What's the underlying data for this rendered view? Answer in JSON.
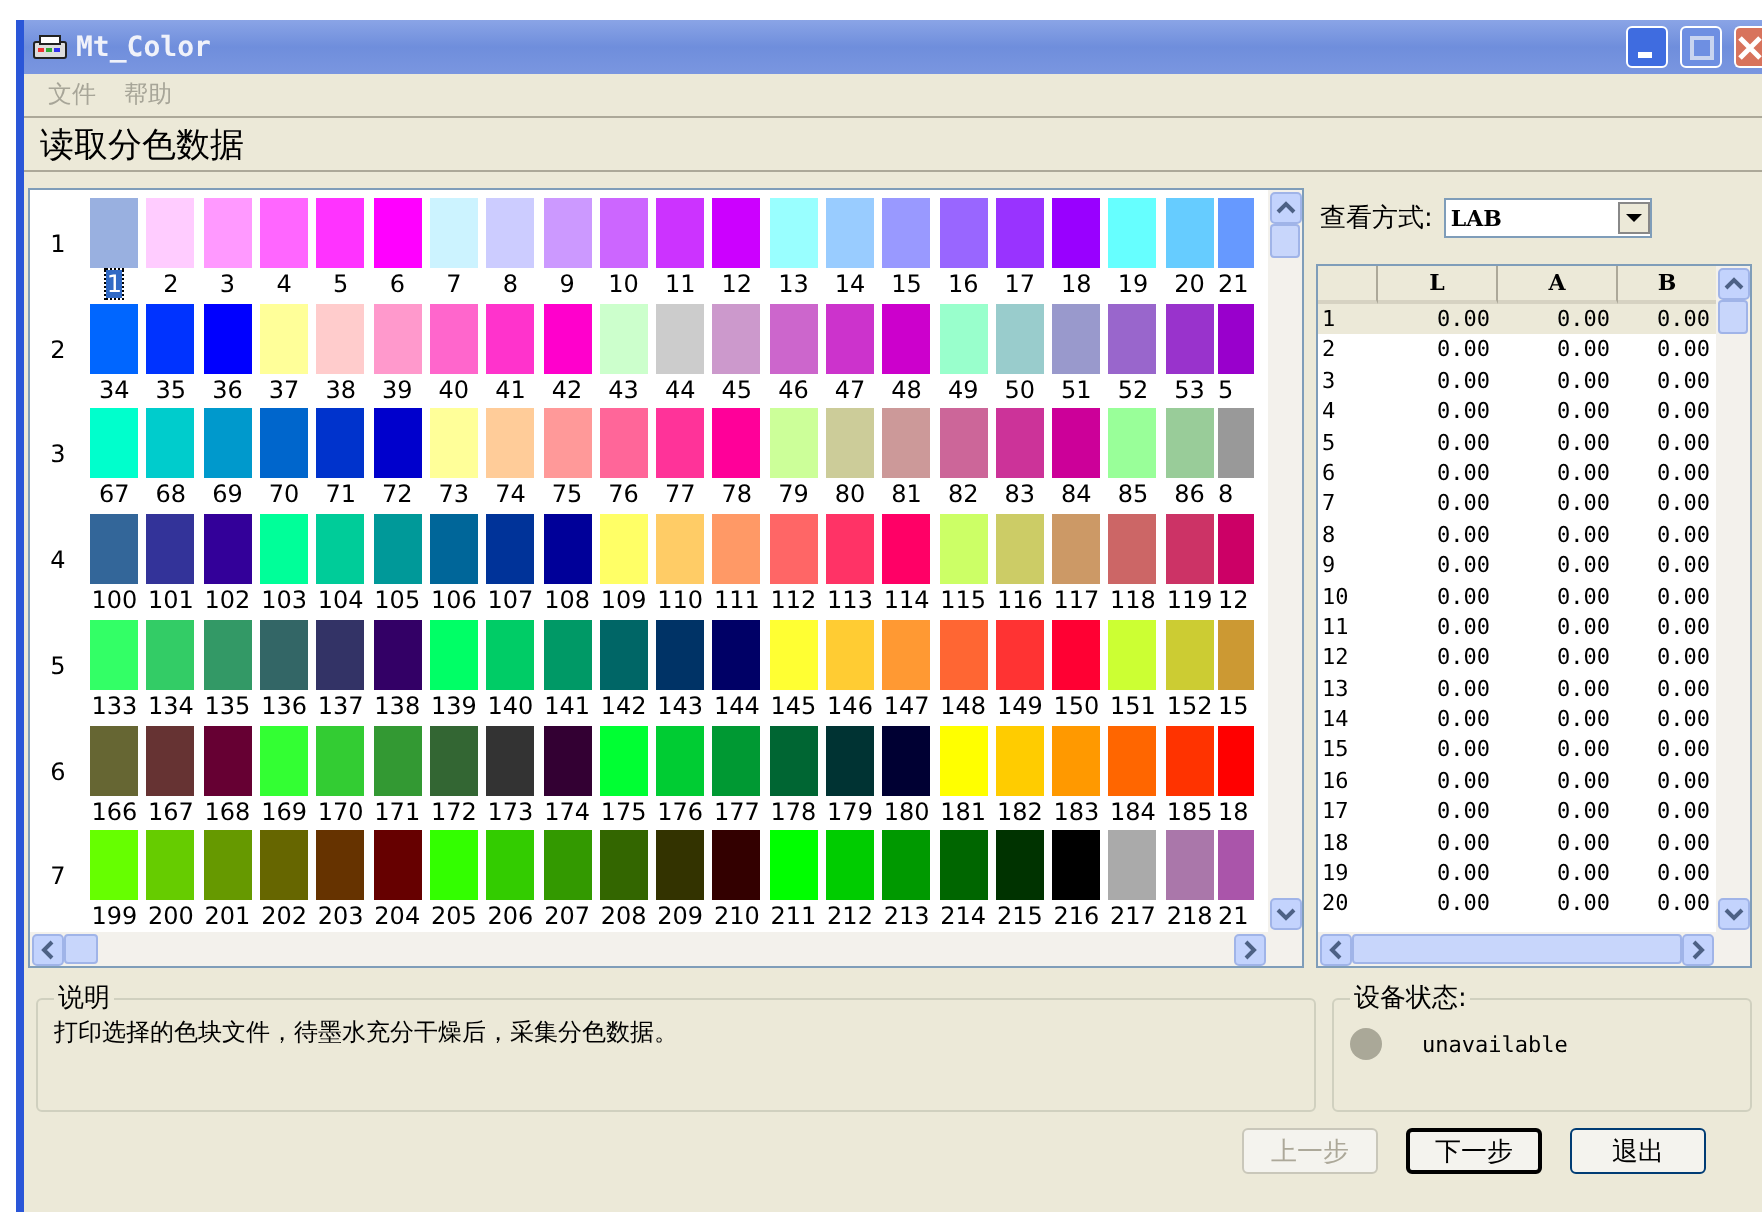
{
  "window": {
    "title": "Mt_Color"
  },
  "menu": [
    {
      "label": "文件",
      "disabled": true
    },
    {
      "label": "帮助",
      "disabled": true
    }
  ],
  "page_title": "读取分色数据",
  "swatch_grid": {
    "rows": [
      {
        "label": "1",
        "swatches": [
          {
            "label": "1",
            "color": "#99b0e0",
            "selected": true
          },
          {
            "label": "2",
            "color": "#ffccff",
            "selected": false
          },
          {
            "label": "3",
            "color": "#ff99ff",
            "selected": false
          },
          {
            "label": "4",
            "color": "#ff66ff",
            "selected": false
          },
          {
            "label": "5",
            "color": "#ff33ff",
            "selected": false
          },
          {
            "label": "6",
            "color": "#ff00ff",
            "selected": false
          },
          {
            "label": "7",
            "color": "#ccf3ff",
            "selected": false
          },
          {
            "label": "8",
            "color": "#ccccff",
            "selected": false
          },
          {
            "label": "9",
            "color": "#cc99ff",
            "selected": false
          },
          {
            "label": "10",
            "color": "#cc66ff",
            "selected": false
          },
          {
            "label": "11",
            "color": "#cc33ff",
            "selected": false
          },
          {
            "label": "12",
            "color": "#cc00ff",
            "selected": false
          },
          {
            "label": "13",
            "color": "#99ffff",
            "selected": false
          },
          {
            "label": "14",
            "color": "#99ccff",
            "selected": false
          },
          {
            "label": "15",
            "color": "#9999ff",
            "selected": false
          },
          {
            "label": "16",
            "color": "#9966ff",
            "selected": false
          },
          {
            "label": "17",
            "color": "#9933ff",
            "selected": false
          },
          {
            "label": "18",
            "color": "#9900ff",
            "selected": false
          },
          {
            "label": "19",
            "color": "#66ffff",
            "selected": false
          },
          {
            "label": "20",
            "color": "#66ccff",
            "selected": false
          },
          {
            "label": "21",
            "color": "#6699ff",
            "selected": false
          }
        ]
      },
      {
        "label": "2",
        "swatches": [
          {
            "label": "34",
            "color": "#0066ff",
            "selected": false
          },
          {
            "label": "35",
            "color": "#0033ff",
            "selected": false
          },
          {
            "label": "36",
            "color": "#0000ff",
            "selected": false
          },
          {
            "label": "37",
            "color": "#ffff99",
            "selected": false
          },
          {
            "label": "38",
            "color": "#ffcccc",
            "selected": false
          },
          {
            "label": "39",
            "color": "#ff99cc",
            "selected": false
          },
          {
            "label": "40",
            "color": "#ff66cc",
            "selected": false
          },
          {
            "label": "41",
            "color": "#ff33cc",
            "selected": false
          },
          {
            "label": "42",
            "color": "#ff00cc",
            "selected": false
          },
          {
            "label": "43",
            "color": "#ccffcc",
            "selected": false
          },
          {
            "label": "44",
            "color": "#cccccc",
            "selected": false
          },
          {
            "label": "45",
            "color": "#cc99cc",
            "selected": false
          },
          {
            "label": "46",
            "color": "#cc66cc",
            "selected": false
          },
          {
            "label": "47",
            "color": "#cc33cc",
            "selected": false
          },
          {
            "label": "48",
            "color": "#cc00cc",
            "selected": false
          },
          {
            "label": "49",
            "color": "#99ffcc",
            "selected": false
          },
          {
            "label": "50",
            "color": "#99cccc",
            "selected": false
          },
          {
            "label": "51",
            "color": "#9999cc",
            "selected": false
          },
          {
            "label": "52",
            "color": "#9966cc",
            "selected": false
          },
          {
            "label": "53",
            "color": "#9933cc",
            "selected": false
          },
          {
            "label": "5",
            "color": "#9900cc",
            "selected": false
          }
        ]
      },
      {
        "label": "3",
        "swatches": [
          {
            "label": "67",
            "color": "#00ffcc",
            "selected": false
          },
          {
            "label": "68",
            "color": "#00cccc",
            "selected": false
          },
          {
            "label": "69",
            "color": "#0099cc",
            "selected": false
          },
          {
            "label": "70",
            "color": "#0066cc",
            "selected": false
          },
          {
            "label": "71",
            "color": "#0033cc",
            "selected": false
          },
          {
            "label": "72",
            "color": "#0000cc",
            "selected": false
          },
          {
            "label": "73",
            "color": "#ffff99",
            "selected": false
          },
          {
            "label": "74",
            "color": "#ffcc99",
            "selected": false
          },
          {
            "label": "75",
            "color": "#ff9999",
            "selected": false
          },
          {
            "label": "76",
            "color": "#ff6699",
            "selected": false
          },
          {
            "label": "77",
            "color": "#ff3399",
            "selected": false
          },
          {
            "label": "78",
            "color": "#ff0099",
            "selected": false
          },
          {
            "label": "79",
            "color": "#ccff99",
            "selected": false
          },
          {
            "label": "80",
            "color": "#cccc99",
            "selected": false
          },
          {
            "label": "81",
            "color": "#cc9999",
            "selected": false
          },
          {
            "label": "82",
            "color": "#cc6699",
            "selected": false
          },
          {
            "label": "83",
            "color": "#cc3399",
            "selected": false
          },
          {
            "label": "84",
            "color": "#cc0099",
            "selected": false
          },
          {
            "label": "85",
            "color": "#99ff99",
            "selected": false
          },
          {
            "label": "86",
            "color": "#99cc99",
            "selected": false
          },
          {
            "label": "8",
            "color": "#999999",
            "selected": false
          }
        ]
      },
      {
        "label": "4",
        "swatches": [
          {
            "label": "100",
            "color": "#336699",
            "selected": false
          },
          {
            "label": "101",
            "color": "#333399",
            "selected": false
          },
          {
            "label": "102",
            "color": "#330099",
            "selected": false
          },
          {
            "label": "103",
            "color": "#00ff99",
            "selected": false
          },
          {
            "label": "104",
            "color": "#00cc99",
            "selected": false
          },
          {
            "label": "105",
            "color": "#009999",
            "selected": false
          },
          {
            "label": "106",
            "color": "#006699",
            "selected": false
          },
          {
            "label": "107",
            "color": "#003399",
            "selected": false
          },
          {
            "label": "108",
            "color": "#000099",
            "selected": false
          },
          {
            "label": "109",
            "color": "#ffff66",
            "selected": false
          },
          {
            "label": "110",
            "color": "#ffcc66",
            "selected": false
          },
          {
            "label": "111",
            "color": "#ff9966",
            "selected": false
          },
          {
            "label": "112",
            "color": "#ff6666",
            "selected": false
          },
          {
            "label": "113",
            "color": "#ff3366",
            "selected": false
          },
          {
            "label": "114",
            "color": "#ff0066",
            "selected": false
          },
          {
            "label": "115",
            "color": "#ccff66",
            "selected": false
          },
          {
            "label": "116",
            "color": "#cccc66",
            "selected": false
          },
          {
            "label": "117",
            "color": "#cc9966",
            "selected": false
          },
          {
            "label": "118",
            "color": "#cc6666",
            "selected": false
          },
          {
            "label": "119",
            "color": "#cc3366",
            "selected": false
          },
          {
            "label": "12",
            "color": "#cc0066",
            "selected": false
          }
        ]
      },
      {
        "label": "5",
        "swatches": [
          {
            "label": "133",
            "color": "#33ff66",
            "selected": false
          },
          {
            "label": "134",
            "color": "#33cc66",
            "selected": false
          },
          {
            "label": "135",
            "color": "#339966",
            "selected": false
          },
          {
            "label": "136",
            "color": "#336666",
            "selected": false
          },
          {
            "label": "137",
            "color": "#333366",
            "selected": false
          },
          {
            "label": "138",
            "color": "#330066",
            "selected": false
          },
          {
            "label": "139",
            "color": "#00ff66",
            "selected": false
          },
          {
            "label": "140",
            "color": "#00cc66",
            "selected": false
          },
          {
            "label": "141",
            "color": "#009966",
            "selected": false
          },
          {
            "label": "142",
            "color": "#006666",
            "selected": false
          },
          {
            "label": "143",
            "color": "#003366",
            "selected": false
          },
          {
            "label": "144",
            "color": "#000066",
            "selected": false
          },
          {
            "label": "145",
            "color": "#ffff33",
            "selected": false
          },
          {
            "label": "146",
            "color": "#ffcc33",
            "selected": false
          },
          {
            "label": "147",
            "color": "#ff9933",
            "selected": false
          },
          {
            "label": "148",
            "color": "#ff6633",
            "selected": false
          },
          {
            "label": "149",
            "color": "#ff3333",
            "selected": false
          },
          {
            "label": "150",
            "color": "#ff0033",
            "selected": false
          },
          {
            "label": "151",
            "color": "#ccff33",
            "selected": false
          },
          {
            "label": "152",
            "color": "#cccc33",
            "selected": false
          },
          {
            "label": "15",
            "color": "#cc9933",
            "selected": false
          }
        ]
      },
      {
        "label": "6",
        "swatches": [
          {
            "label": "166",
            "color": "#666633",
            "selected": false
          },
          {
            "label": "167",
            "color": "#663333",
            "selected": false
          },
          {
            "label": "168",
            "color": "#660033",
            "selected": false
          },
          {
            "label": "169",
            "color": "#33ff33",
            "selected": false
          },
          {
            "label": "170",
            "color": "#33cc33",
            "selected": false
          },
          {
            "label": "171",
            "color": "#339933",
            "selected": false
          },
          {
            "label": "172",
            "color": "#336633",
            "selected": false
          },
          {
            "label": "173",
            "color": "#333333",
            "selected": false
          },
          {
            "label": "174",
            "color": "#330033",
            "selected": false
          },
          {
            "label": "175",
            "color": "#00ff33",
            "selected": false
          },
          {
            "label": "176",
            "color": "#00cc33",
            "selected": false
          },
          {
            "label": "177",
            "color": "#009933",
            "selected": false
          },
          {
            "label": "178",
            "color": "#006633",
            "selected": false
          },
          {
            "label": "179",
            "color": "#003333",
            "selected": false
          },
          {
            "label": "180",
            "color": "#000033",
            "selected": false
          },
          {
            "label": "181",
            "color": "#ffff00",
            "selected": false
          },
          {
            "label": "182",
            "color": "#ffcc00",
            "selected": false
          },
          {
            "label": "183",
            "color": "#ff9900",
            "selected": false
          },
          {
            "label": "184",
            "color": "#ff6600",
            "selected": false
          },
          {
            "label": "185",
            "color": "#ff3300",
            "selected": false
          },
          {
            "label": "18",
            "color": "#ff0000",
            "selected": false
          }
        ]
      },
      {
        "label": "7",
        "swatches": [
          {
            "label": "199",
            "color": "#66ff00",
            "selected": false
          },
          {
            "label": "200",
            "color": "#66cc00",
            "selected": false
          },
          {
            "label": "201",
            "color": "#669900",
            "selected": false
          },
          {
            "label": "202",
            "color": "#666600",
            "selected": false
          },
          {
            "label": "203",
            "color": "#663300",
            "selected": false
          },
          {
            "label": "204",
            "color": "#660000",
            "selected": false
          },
          {
            "label": "205",
            "color": "#33ff00",
            "selected": false
          },
          {
            "label": "206",
            "color": "#33cc00",
            "selected": false
          },
          {
            "label": "207",
            "color": "#339900",
            "selected": false
          },
          {
            "label": "208",
            "color": "#336600",
            "selected": false
          },
          {
            "label": "209",
            "color": "#333300",
            "selected": false
          },
          {
            "label": "210",
            "color": "#330000",
            "selected": false
          },
          {
            "label": "211",
            "color": "#00ff00",
            "selected": false
          },
          {
            "label": "212",
            "color": "#00cc00",
            "selected": false
          },
          {
            "label": "213",
            "color": "#009900",
            "selected": false
          },
          {
            "label": "214",
            "color": "#006600",
            "selected": false
          },
          {
            "label": "215",
            "color": "#003300",
            "selected": false
          },
          {
            "label": "216",
            "color": "#000000",
            "selected": false
          },
          {
            "label": "217",
            "color": "#aaaaaa",
            "selected": false
          },
          {
            "label": "218",
            "color": "#aa77aa",
            "selected": false
          },
          {
            "label": "21",
            "color": "#aa55aa",
            "selected": false
          }
        ]
      }
    ]
  },
  "view_mode": {
    "label": "查看方式:",
    "value": "LAB"
  },
  "table": {
    "columns": [
      "L",
      "A",
      "B"
    ],
    "rows": [
      {
        "index": "1",
        "l": "0.00",
        "a": "0.00",
        "b": "0.00",
        "selected": true
      },
      {
        "index": "2",
        "l": "0.00",
        "a": "0.00",
        "b": "0.00",
        "selected": false
      },
      {
        "index": "3",
        "l": "0.00",
        "a": "0.00",
        "b": "0.00",
        "selected": false
      },
      {
        "index": "4",
        "l": "0.00",
        "a": "0.00",
        "b": "0.00",
        "selected": false
      },
      {
        "index": "5",
        "l": "0.00",
        "a": "0.00",
        "b": "0.00",
        "selected": false
      },
      {
        "index": "6",
        "l": "0.00",
        "a": "0.00",
        "b": "0.00",
        "selected": false
      },
      {
        "index": "7",
        "l": "0.00",
        "a": "0.00",
        "b": "0.00",
        "selected": false
      },
      {
        "index": "8",
        "l": "0.00",
        "a": "0.00",
        "b": "0.00",
        "selected": false
      },
      {
        "index": "9",
        "l": "0.00",
        "a": "0.00",
        "b": "0.00",
        "selected": false
      },
      {
        "index": "10",
        "l": "0.00",
        "a": "0.00",
        "b": "0.00",
        "selected": false
      },
      {
        "index": "11",
        "l": "0.00",
        "a": "0.00",
        "b": "0.00",
        "selected": false
      },
      {
        "index": "12",
        "l": "0.00",
        "a": "0.00",
        "b": "0.00",
        "selected": false
      },
      {
        "index": "13",
        "l": "0.00",
        "a": "0.00",
        "b": "0.00",
        "selected": false
      },
      {
        "index": "14",
        "l": "0.00",
        "a": "0.00",
        "b": "0.00",
        "selected": false
      },
      {
        "index": "15",
        "l": "0.00",
        "a": "0.00",
        "b": "0.00",
        "selected": false
      },
      {
        "index": "16",
        "l": "0.00",
        "a": "0.00",
        "b": "0.00",
        "selected": false
      },
      {
        "index": "17",
        "l": "0.00",
        "a": "0.00",
        "b": "0.00",
        "selected": false
      },
      {
        "index": "18",
        "l": "0.00",
        "a": "0.00",
        "b": "0.00",
        "selected": false
      },
      {
        "index": "19",
        "l": "0.00",
        "a": "0.00",
        "b": "0.00",
        "selected": false
      },
      {
        "index": "20",
        "l": "0.00",
        "a": "0.00",
        "b": "0.00",
        "selected": false
      }
    ]
  },
  "description": {
    "title": "说明",
    "text": "打印选择的色块文件，待墨水充分干燥后，采集分色数据。"
  },
  "device_status": {
    "title": "设备状态:",
    "label": "unavailable",
    "color": "#aaa898"
  },
  "buttons": [
    {
      "label": "上一步",
      "disabled": true,
      "default": false
    },
    {
      "label": "下一步",
      "disabled": false,
      "default": true
    },
    {
      "label": "退出",
      "disabled": false,
      "default": false
    }
  ]
}
